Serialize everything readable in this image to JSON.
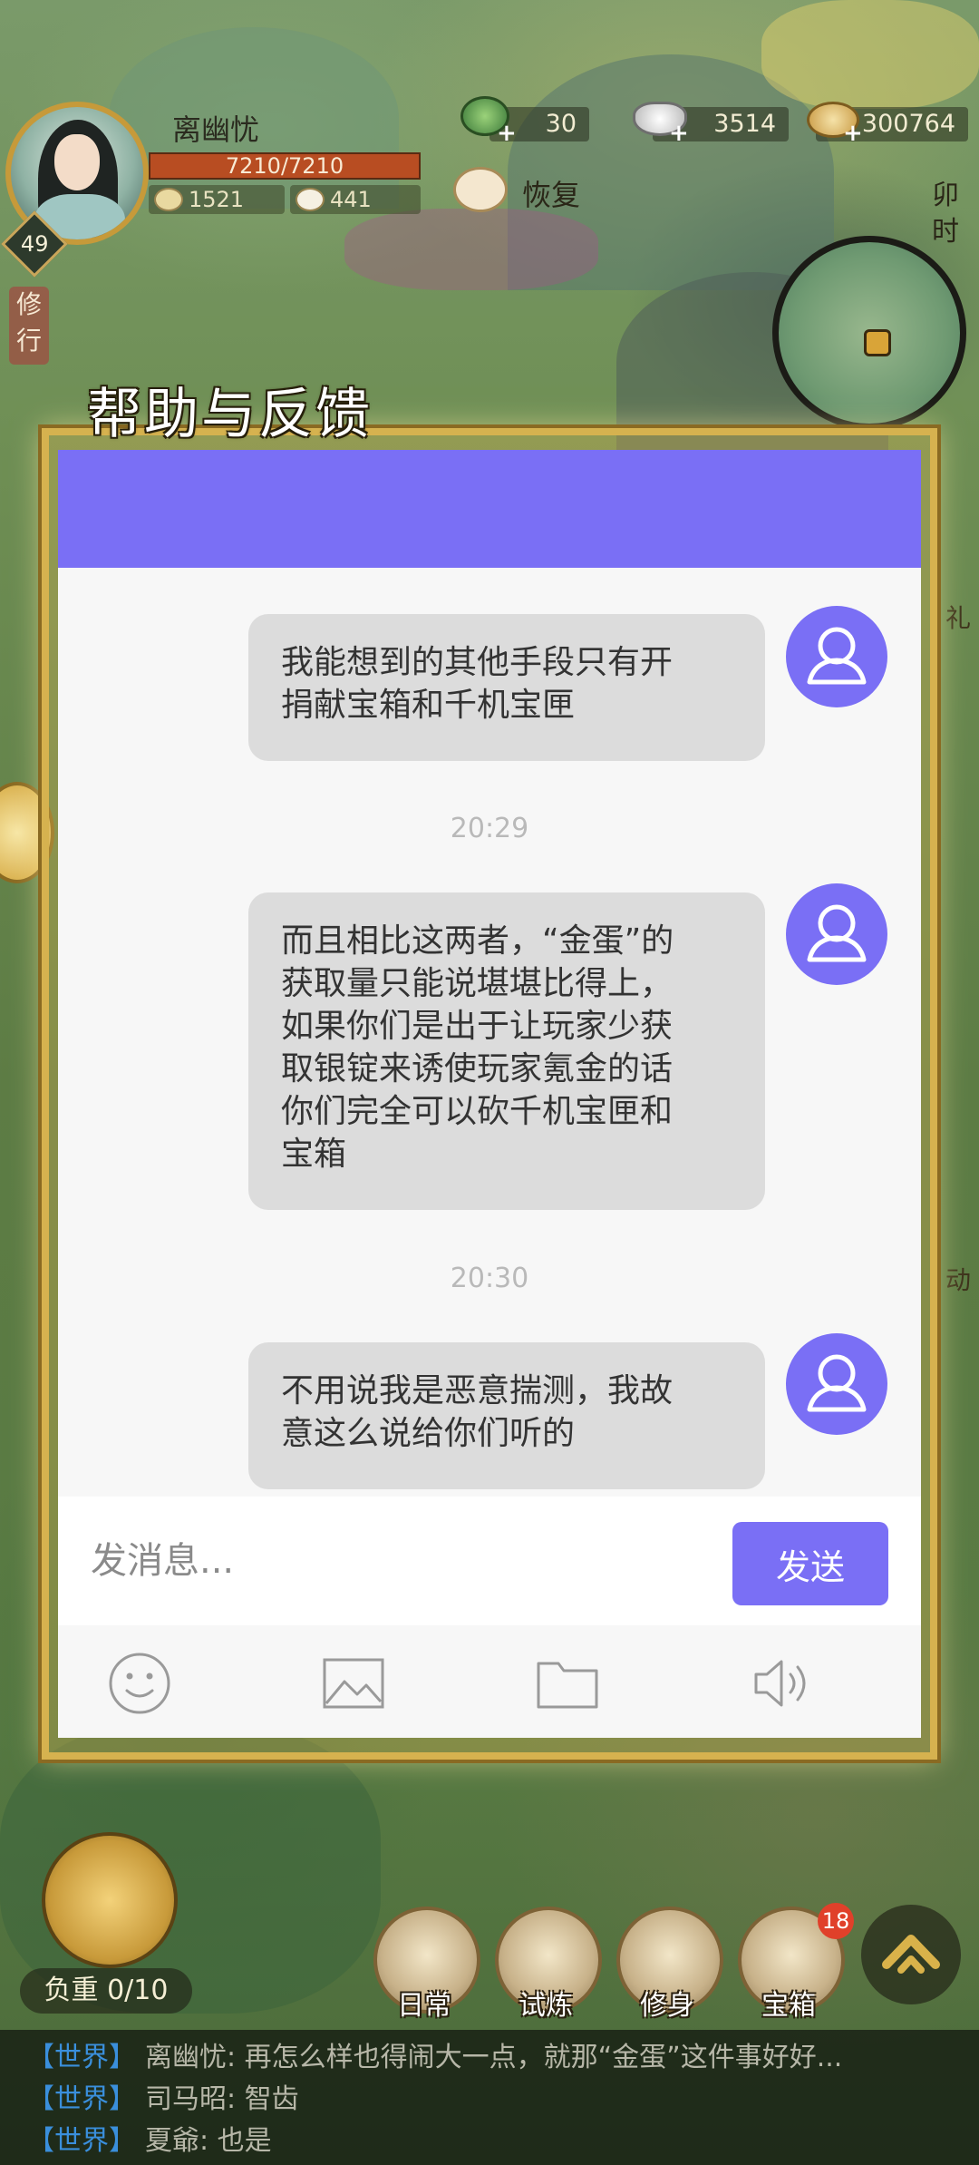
{
  "hud": {
    "player_name": "离幽忧",
    "level": "49",
    "hp": "7210/7210",
    "stat_a": "1521",
    "stat_b": "441",
    "resource_jade": "30",
    "resource_silver": "3514",
    "resource_copper": "300764",
    "restore_label": "恢复",
    "time_of_day": "卯时",
    "cultivate_label": "修行",
    "right_peek": [
      "礼",
      "动"
    ]
  },
  "dialog": {
    "title": "帮助与反馈",
    "messages": [
      {
        "text": "我能想到的其他手段只有开\n捐献宝箱和千机宝匣"
      },
      {
        "text": "而且相比这两者，“金蛋”的\n获取量只能说堪堪比得上，\n如果你们是出于让玩家少获\n取银锭来诱使玩家氪金的话\n你们完全可以砍千机宝匣和\n宝箱"
      },
      {
        "text": "不用说我是恶意揣测，我故\n意这么说给你们听的"
      }
    ],
    "timestamps": [
      "20:29",
      "20:30"
    ],
    "input_placeholder": "发消息...",
    "send_label": "发送",
    "accent_color": "#7a6ff5"
  },
  "bottom": {
    "load_label": "负重 0/10",
    "buttons": [
      "日常",
      "试炼",
      "修身",
      "宝箱"
    ],
    "treasure_badge": "18"
  },
  "world_chat": [
    {
      "channel": "【世界】",
      "text": "离幽忧: 再怎么样也得闹大一点，就那“金蛋”这件事好好..."
    },
    {
      "channel": "【世界】",
      "text": "司马昭: 智齿"
    },
    {
      "channel": "【世界】",
      "text": "夏爺: 也是"
    }
  ]
}
